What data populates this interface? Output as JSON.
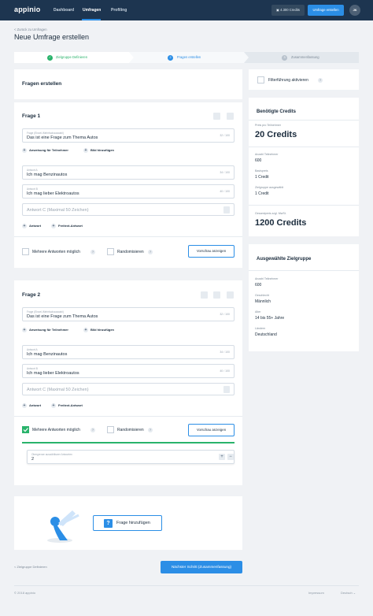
{
  "header": {
    "logo": "appinio",
    "nav": [
      "Dashboard",
      "Umfragen",
      "Profiling"
    ],
    "credits": "4.300 Credits",
    "create_survey": "Umfrage erstellen",
    "avatar": "JK"
  },
  "breadcrumb": "< Zurück zu Umfragen",
  "page_title": "Neue Umfrage erstellen",
  "stepper": {
    "steps": [
      {
        "number": "✓",
        "label": "Zielgruppe Definieren",
        "state": "done"
      },
      {
        "number": "2",
        "label": "Fragen erstellen",
        "state": "active"
      },
      {
        "number": "3",
        "label": "Zusammenfassung",
        "state": "pending"
      }
    ]
  },
  "questions_section": {
    "title": "Fragen erstellen",
    "filter_label": "Filterführung aktivieren"
  },
  "question1": {
    "title": "Frage 1",
    "question_label": "Frage (Einzel-/Mehrfachauswahl)",
    "question_value": "Das ist eine Frage zum Thema Autos",
    "question_count": "32 / 100",
    "instruction_action": "Anweisung für Teilnehmer",
    "image_action": "Bild hinzufügen",
    "answer_a_label": "Antwort A",
    "answer_a_value": "Ich mag Benzinautos",
    "answer_a_count": "34 / 100",
    "answer_b_label": "Antwort B",
    "answer_b_value": "Ich mag lieber Elektroautos",
    "answer_b_count": "40 / 100",
    "answer_c_placeholder": "Antwort C (Maximal 50 Zeichen)",
    "add_answer": "Antwort",
    "add_free_text": "Freitext-Antwort",
    "multi_label": "Mehrere Antworten möglich",
    "randomize_label": "Randomisieren",
    "preview": "Vorschau anzeigen",
    "multi_checked": false
  },
  "question2": {
    "title": "Frage 2",
    "question_label": "Frage (Einzel-/Mehrfachauswahl)",
    "question_value": "Das ist eine Frage zum Thema Autos",
    "question_count": "32 / 100",
    "instruction_action": "Anweisung für Teilnehmer",
    "image_action": "Bild hinzufügen",
    "answer_a_label": "Antwort A",
    "answer_a_value": "Ich mag Benzinautos",
    "answer_a_count": "34 / 100",
    "answer_b_label": "Antwort B",
    "answer_b_value": "Ich mag lieber Elektroautos",
    "answer_b_count": "40 / 100",
    "answer_c_placeholder": "Antwort C (Maximal 50 Zeichen)",
    "add_answer": "Antwort",
    "add_free_text": "Freitext-Antwort",
    "multi_label": "Mehrere Antworten möglich",
    "randomize_label": "Randomisieren",
    "preview": "Vorschau anzeigen",
    "multi_checked": true,
    "max_label": "Obergrenze auswählbarer Antworten",
    "max_value": "2"
  },
  "add_question": "Frage hinzufügen",
  "credits_panel": {
    "title": "Benötigte Credits",
    "price_label": "Preis pro Teilnehmer",
    "price_value": "20 Credits",
    "participants_label": "Anzahl Teilnehmer",
    "participants_value": "600",
    "base_label": "Basispreis",
    "base_value": "1 Credit",
    "target_label": "Zielgruppe ausgewählt",
    "target_value": "1 Credit",
    "total_label": "Gesamtpreis zzgl. MwSt.",
    "total_value": "1200 Credits"
  },
  "target_panel": {
    "title": "Ausgewählte Zielgruppe",
    "participants_label": "Anzahl Teilnehmer",
    "participants_value": "600",
    "gender_label": "Geschlecht",
    "gender_value": "Männlich",
    "age_label": "Alter",
    "age_value": "14 bis 55+ Jahre",
    "country_label": "Ländern",
    "country_value": "Deutschland"
  },
  "bottom": {
    "back": "< Zielgruppe Definieren",
    "next": "Nächster Schritt (Zusammenfassung)"
  },
  "footer": {
    "copyright": "© 2018 appinio",
    "imprint": "Impressum",
    "language": "Deutsch"
  },
  "colors": {
    "navy": "#1d3550",
    "accent": "#2b8ee6",
    "success": "#29b36b"
  }
}
